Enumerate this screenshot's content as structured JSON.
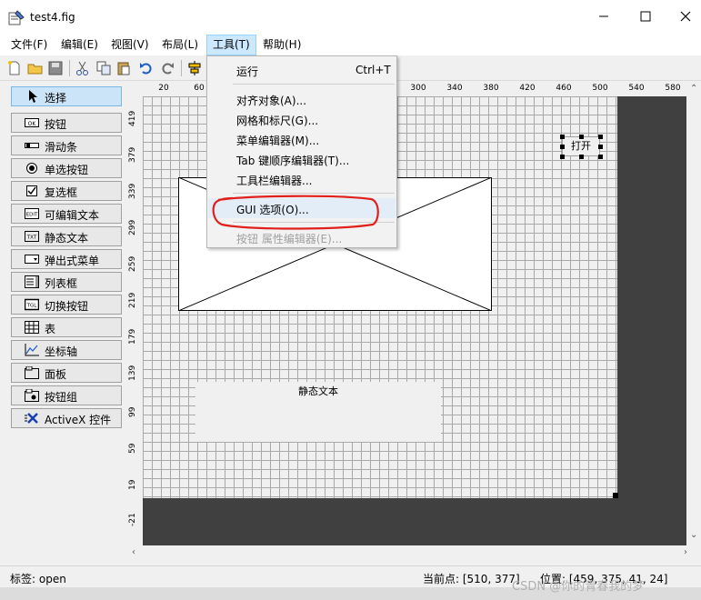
{
  "window": {
    "title": "test4.fig"
  },
  "menubar": [
    {
      "label": "文件(F)"
    },
    {
      "label": "编辑(E)"
    },
    {
      "label": "视图(V)"
    },
    {
      "label": "布局(L)"
    },
    {
      "label": "工具(T)",
      "active": true
    },
    {
      "label": "帮助(H)"
    }
  ],
  "toolbar": {
    "icons": [
      "new-file-icon",
      "open-folder-icon",
      "save-icon",
      "cut-icon",
      "copy-icon",
      "paste-icon",
      "undo-icon",
      "redo-icon",
      "align-icon"
    ]
  },
  "palette": {
    "items": [
      {
        "label": "选择",
        "icon": "arrow-select-icon",
        "selected": true
      },
      {
        "label": "按钮",
        "icon": "pushbutton-icon"
      },
      {
        "label": "滑动条",
        "icon": "slider-icon"
      },
      {
        "label": "单选按钮",
        "icon": "radio-button-icon"
      },
      {
        "label": "复选框",
        "icon": "checkbox-icon"
      },
      {
        "label": "可编辑文本",
        "icon": "edit-text-icon"
      },
      {
        "label": "静态文本",
        "icon": "static-text-icon"
      },
      {
        "label": "弹出式菜单",
        "icon": "popup-menu-icon"
      },
      {
        "label": "列表框",
        "icon": "listbox-icon"
      },
      {
        "label": "切换按钮",
        "icon": "toggle-button-icon"
      },
      {
        "label": "表",
        "icon": "table-icon"
      },
      {
        "label": "坐标轴",
        "icon": "axes-icon"
      },
      {
        "label": "面板",
        "icon": "panel-icon"
      },
      {
        "label": "按钮组",
        "icon": "button-group-icon"
      },
      {
        "label": "ActiveX 控件",
        "icon": "activex-icon"
      }
    ]
  },
  "ruler_top": [
    "20",
    "60",
    "300",
    "340",
    "380",
    "420",
    "460",
    "500",
    "540",
    "580"
  ],
  "ruler_left": [
    "419",
    "379",
    "339",
    "299",
    "259",
    "219",
    "179",
    "139",
    "99",
    "59",
    "19",
    "-21"
  ],
  "canvas": {
    "static_text": "静态文本",
    "open_button": "打开"
  },
  "tools_menu": {
    "items": [
      {
        "label": "运行",
        "shortcut": "Ctrl+T"
      },
      {
        "label": "对齐对象(A)..."
      },
      {
        "label": "网格和标尺(G)..."
      },
      {
        "label": "菜单编辑器(M)..."
      },
      {
        "label": "Tab 键顺序编辑器(T)..."
      },
      {
        "label": "工具栏编辑器..."
      },
      {
        "label": "GUI 选项(O)...",
        "highlighted": true
      },
      {
        "label": "按钮 属性编辑器(E)...",
        "disabled": true
      }
    ]
  },
  "annotation_color": "#e0201a",
  "status": {
    "tag": "标签: open",
    "current_point": "当前点:  [510, 377]",
    "position": "位置:  [459, 375, 41, 24]"
  },
  "watermark": "CSDN @你的青春我的梦"
}
